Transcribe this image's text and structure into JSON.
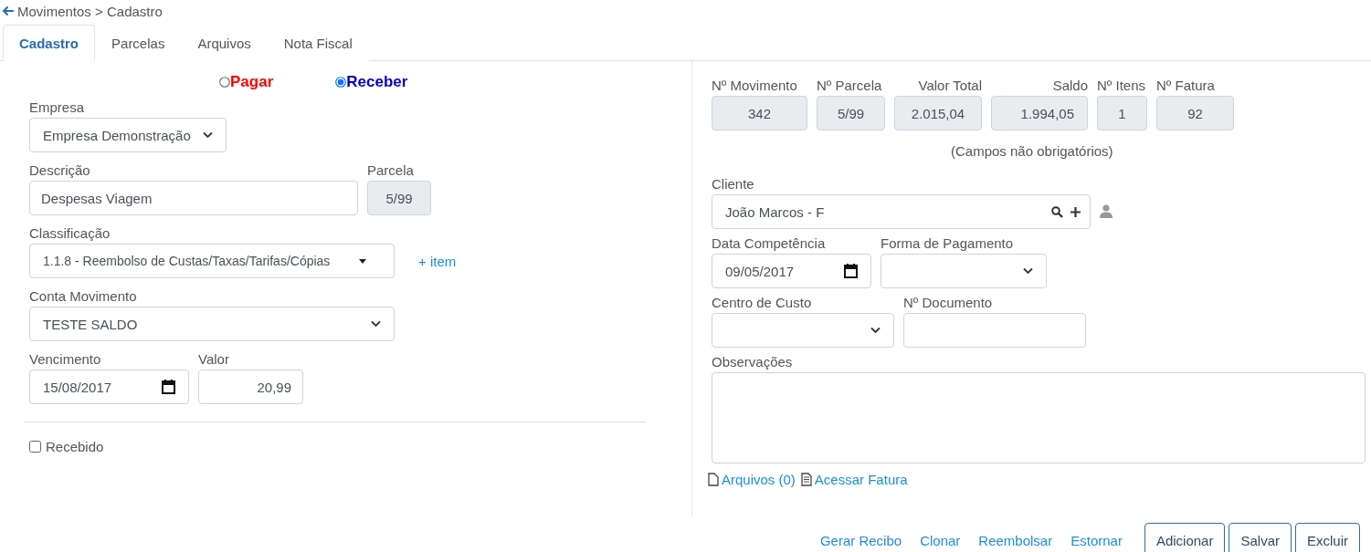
{
  "breadcrumb": "Movimentos > Cadastro",
  "tabs": [
    {
      "label": "Cadastro",
      "selected": true
    },
    {
      "label": "Parcelas",
      "selected": false
    },
    {
      "label": "Arquivos",
      "selected": false
    },
    {
      "label": "Nota Fiscal",
      "selected": false
    }
  ],
  "type_options": [
    {
      "label": "Pagar",
      "selected": false,
      "color": "#ff0000"
    },
    {
      "label": "Receber",
      "selected": true,
      "color": "#0000cc"
    }
  ],
  "left_rows": [
    [
      {
        "kind": "select",
        "label": "Empresa",
        "value": "Empresa Demonstração"
      }
    ],
    [
      {
        "kind": "input",
        "label": "Descrição",
        "value": "Despesas Viagem"
      },
      {
        "kind": "readonly",
        "label": "Parcela",
        "value": "5/99"
      }
    ],
    [
      {
        "kind": "dropdown",
        "label": "Classificação",
        "value": "1.1.8 - Reembolso de Custas/Taxas/Tarifas/Cópias",
        "link": "+ item"
      }
    ],
    [
      {
        "kind": "select",
        "label": "Conta Movimento",
        "value": "TESTE SALDO"
      }
    ],
    [
      {
        "kind": "date",
        "label": "Vencimento",
        "value": "15/08/2017"
      },
      {
        "kind": "number",
        "label": "Valor",
        "value": "20,99"
      }
    ]
  ],
  "received": {
    "label": "Recebido",
    "checked": false
  },
  "summary": [
    {
      "label": "Nº Movimento",
      "value": "342"
    },
    {
      "label": "Nº Parcela",
      "value": "5/99"
    },
    {
      "label": "Valor Total",
      "value": "2.015,04"
    },
    {
      "label": "Saldo",
      "value": "1.994,05"
    },
    {
      "label": "Nº Itens",
      "value": "1"
    },
    {
      "label": "Nº Fatura",
      "value": "92"
    }
  ],
  "note": "(Campos não obrigatórios)",
  "right_rows": [
    [
      {
        "kind": "lookup",
        "label": "Cliente",
        "value": "João Marcos - F"
      }
    ],
    [
      {
        "kind": "date",
        "label": "Data Competência",
        "value": "09/05/2017"
      },
      {
        "kind": "select",
        "label": "Forma de Pagamento"
      }
    ],
    [
      {
        "kind": "select",
        "label": "Centro de Custo"
      },
      {
        "kind": "input",
        "label": "Nº Documento"
      }
    ],
    [
      {
        "kind": "textarea",
        "label": "Observações"
      }
    ]
  ],
  "file_links": [
    {
      "kind": "file",
      "label": "Arquivos (0)"
    },
    {
      "kind": "document",
      "label": "Acessar Fatura"
    }
  ],
  "action_links": [
    "Gerar Recibo",
    "Clonar",
    "Reembolsar",
    "Estornar"
  ],
  "buttons": [
    "Adicionar",
    "Salvar",
    "Excluir"
  ]
}
